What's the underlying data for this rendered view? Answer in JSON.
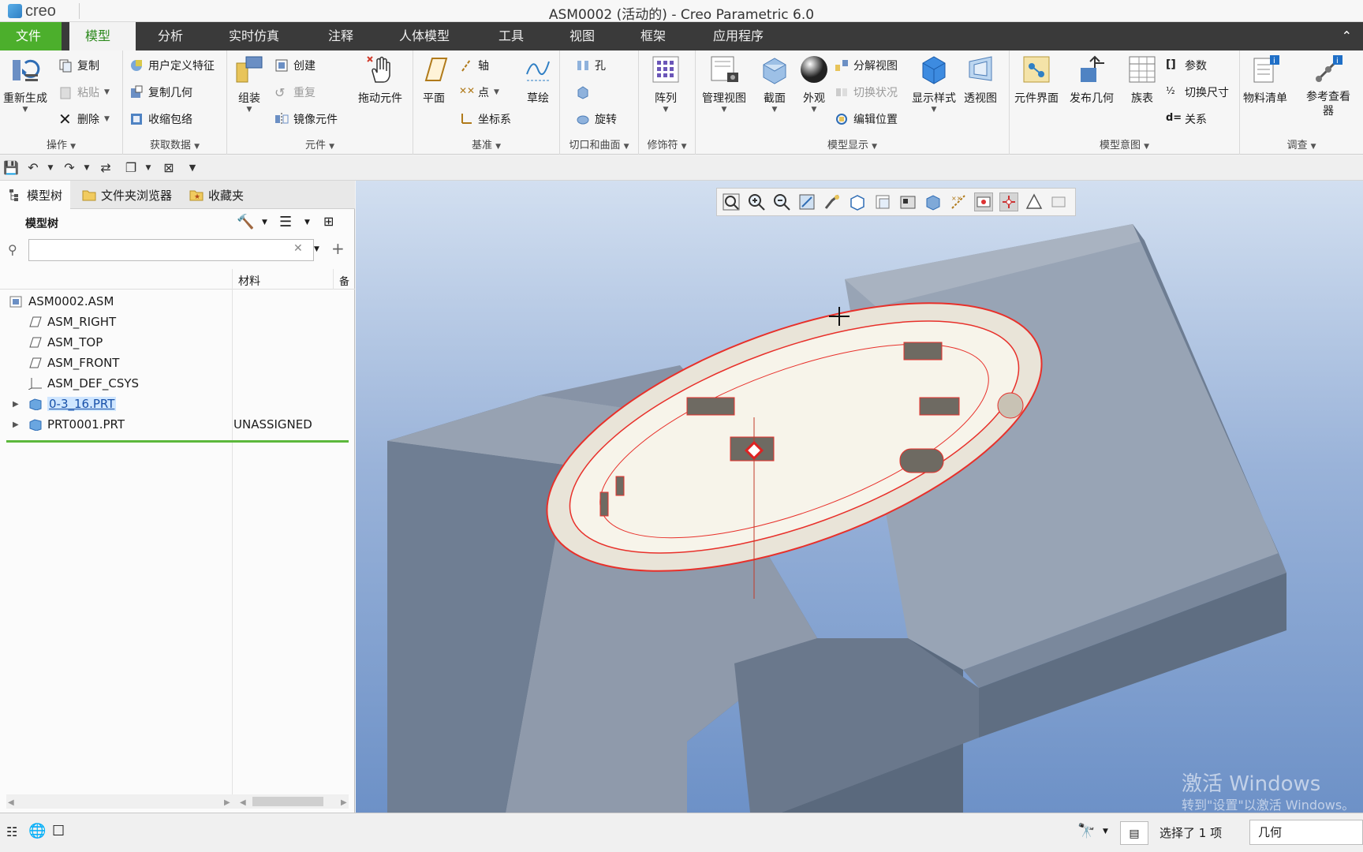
{
  "window": {
    "logo": "creo",
    "title": "ASM0002 (活动的) - Creo Parametric 6.0"
  },
  "menu": {
    "file": "文件",
    "items": [
      "模型",
      "分析",
      "实时仿真",
      "注释",
      "人体模型",
      "工具",
      "视图",
      "框架",
      "应用程序"
    ]
  },
  "ribbon": {
    "groups": {
      "ops": "操作",
      "get": "获取数据",
      "comp": "元件",
      "datum": "基准",
      "cut": "切口和曲面",
      "mod": "修饰符",
      "display": "模型显示",
      "intent": "模型意图",
      "investigate": "调查"
    },
    "regenerate": "重新生成",
    "copy": "复制",
    "paste": "粘贴",
    "delete": "删除",
    "udf": "用户定义特征",
    "copy_geom": "复制几何",
    "shrinkwrap": "收缩包络",
    "assemble": "组装",
    "create": "创建",
    "repeat": "重复",
    "mirror": "镜像元件",
    "drag": "拖动元件",
    "plane": "平面",
    "axis": "轴",
    "point": "点",
    "csys": "坐标系",
    "sketch": "草绘",
    "hole": "孔",
    "revolve": "旋转",
    "pattern": "阵列",
    "manage_views": "管理视图",
    "section": "截面",
    "appearance": "外观",
    "explode": "分解视图",
    "toggle_status": "切换状况",
    "edit_position": "编辑位置",
    "display_style": "显示样式",
    "perspective": "透视图",
    "comp_interface": "元件界面",
    "publish_geom": "发布几何",
    "family_table": "族表",
    "params": "参数",
    "switch_dims": "切换尺寸",
    "relations": "关系",
    "bom": "物料清单",
    "ref_viewer": "参考查看器"
  },
  "left": {
    "tabs": [
      "模型树",
      "文件夹浏览器",
      "收藏夹"
    ],
    "tree_title": "模型树",
    "filter_placeholder": "",
    "col_material": "材料",
    "col_note": "备",
    "tree": [
      {
        "name": "ASM0002.ASM",
        "material": ""
      },
      {
        "name": "ASM_RIGHT",
        "material": ""
      },
      {
        "name": "ASM_TOP",
        "material": ""
      },
      {
        "name": "ASM_FRONT",
        "material": ""
      },
      {
        "name": "ASM_DEF_CSYS",
        "material": ""
      },
      {
        "name": "0-3_16.PRT",
        "material": ""
      },
      {
        "name": "PRT0001.PRT",
        "material": "UNASSIGNED"
      }
    ]
  },
  "viewport": {
    "watermark_title": "激活 Windows",
    "watermark_sub": "转到\"设置\"以激活 Windows。"
  },
  "status": {
    "selection": "选择了 1 项",
    "filter": "几何"
  },
  "colors": {
    "brand_green": "#4caf2c",
    "menubar": "#3a3a3a",
    "edge_red": "#e8302a"
  }
}
